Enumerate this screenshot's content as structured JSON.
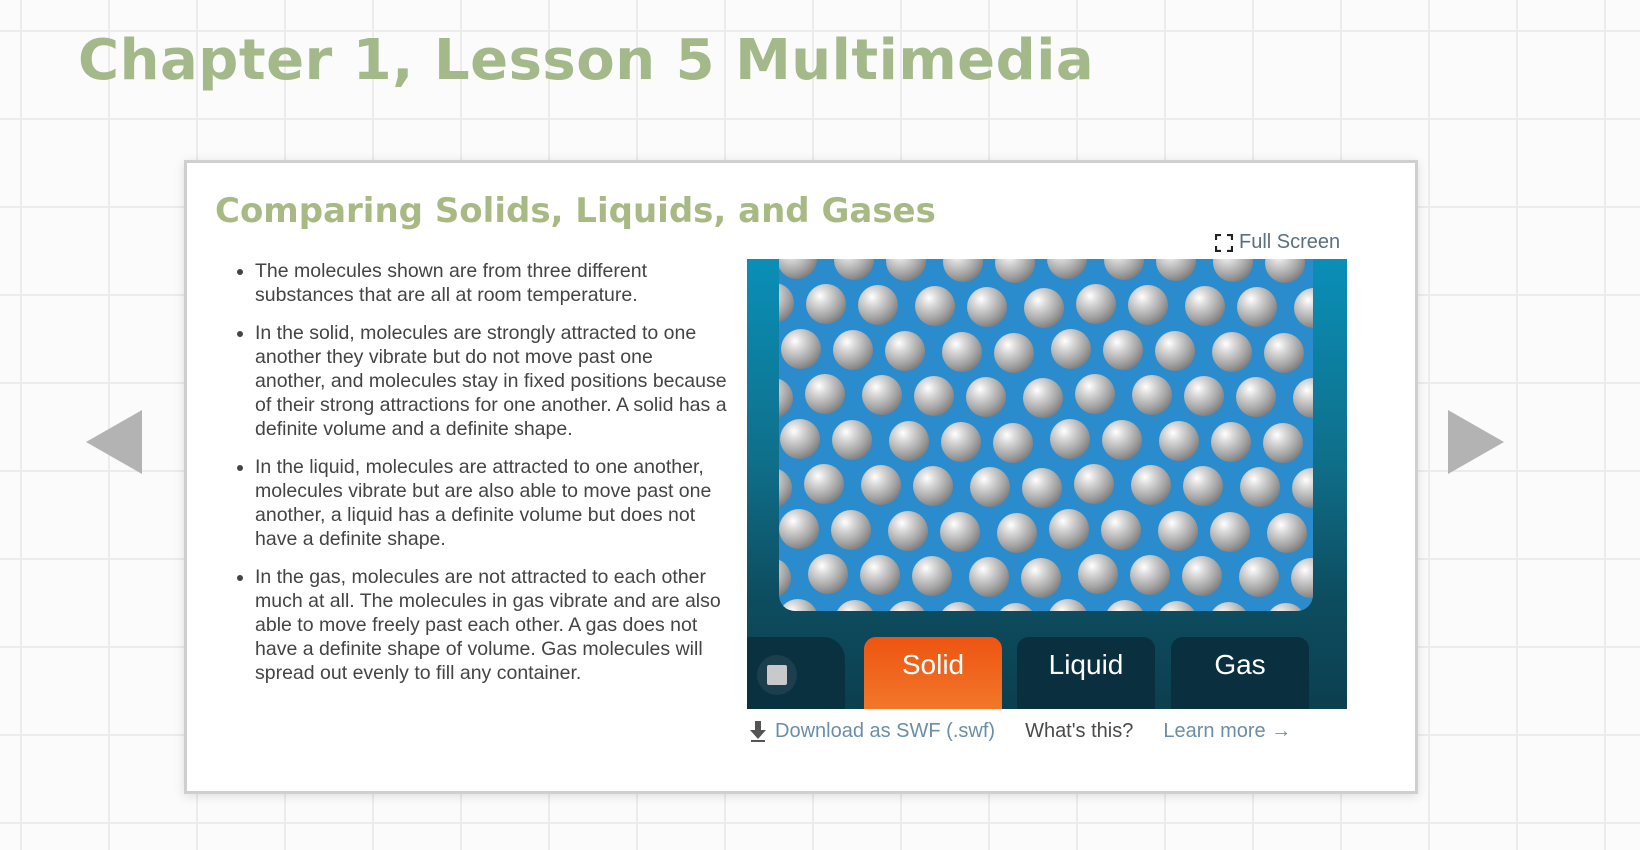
{
  "page": {
    "title": "Chapter 1, Lesson 5 Multimedia"
  },
  "card": {
    "title": "Comparing Solids, Liquids, and Gases",
    "bullets": [
      "The molecules shown are from three different substances that are all at room temperature.",
      "In the solid, molecules are strongly attracted to one another they vibrate but do not move past one another, and molecules stay in fixed positions because of their strong attractions for one another. A solid has a definite volume and a definite shape.",
      "In the liquid, molecules are attracted to one another, molecules vibrate but are also able to move past one another, a liquid has a definite volume but does not have a definite shape.",
      "In the gas, molecules are not attracted to each other much at all. The molecules in gas vibrate and are also able to move freely past each other. A gas does not have a definite shape of volume. Gas molecules will spread out evenly to fill any container."
    ],
    "fullscreen_label": "Full Screen"
  },
  "simulation": {
    "tabs": [
      {
        "label": "Solid",
        "active": true
      },
      {
        "label": "Liquid",
        "active": false
      },
      {
        "label": "Gas",
        "active": false
      }
    ],
    "stop_icon": "stop-icon"
  },
  "links": {
    "download_label": "Download as SWF (.swf)",
    "whats_this": "What's this?",
    "learn_more": "Learn more →"
  },
  "icons": {
    "prev": "left-triangle-arrow-icon",
    "next": "right-triangle-arrow-icon",
    "fullscreen": "fullscreen-brackets-icon",
    "download": "download-arrow-icon"
  },
  "colors": {
    "title_green": "#a3b98a",
    "active_tab": "#ee5411",
    "tab_dark": "#0a2f3e",
    "sim_blue": "#2a8ccd",
    "link_blue": "#6b8ea8"
  }
}
